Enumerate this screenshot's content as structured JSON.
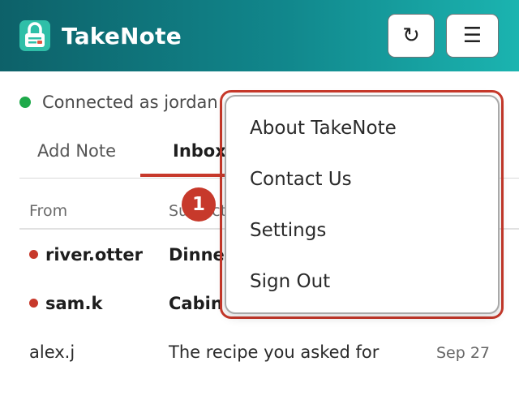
{
  "app": {
    "title": "TakeNote",
    "logo_icon": "lock-note-icon"
  },
  "header": {
    "refresh_glyph": "↻",
    "menu_glyph": "☰"
  },
  "status": {
    "text": "Connected as jordan",
    "color": "#1ea94a"
  },
  "tabs": [
    {
      "label": "Add Note",
      "active": false
    },
    {
      "label": "Inbox",
      "active": true
    }
  ],
  "table": {
    "columns": [
      "From",
      "Subject"
    ],
    "rows": [
      {
        "from": "river.otter",
        "subject": "Dinner",
        "date": "",
        "unread": true
      },
      {
        "from": "sam.k",
        "subject": "Cabin",
        "date": "",
        "unread": true
      },
      {
        "from": "alex.j",
        "subject": "The recipe you asked for",
        "date": "Sep 27",
        "unread": false
      }
    ]
  },
  "menu": {
    "items": [
      "About TakeNote",
      "Contact Us",
      "Settings",
      "Sign Out"
    ]
  },
  "badge": {
    "label": "1"
  },
  "colors": {
    "accent": "#c7392b",
    "header_start": "#0d6169",
    "header_end": "#1bb4b0"
  }
}
